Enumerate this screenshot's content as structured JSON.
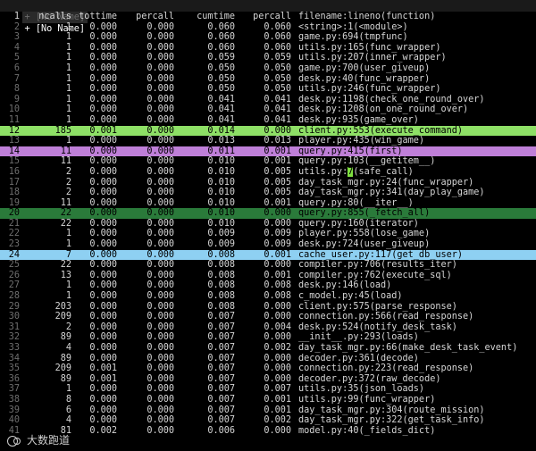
{
  "tabs": [
    {
      "label": "+ [No Name]",
      "active": false
    },
    {
      "label": "+ [No Name]",
      "active": true
    }
  ],
  "header": {
    "ncalls": "ncalls",
    "tottime": "tottime",
    "percall1": "percall",
    "cumtime": "cumtime",
    "percall2": "percall",
    "func": "filename:lineno(function)"
  },
  "rows": [
    {
      "ln": "2",
      "ncalls": "1",
      "tottime": "0.000",
      "percall1": "0.000",
      "cumtime": "0.060",
      "percall2": "0.060",
      "func": "<string>:1(<module>)",
      "hl": ""
    },
    {
      "ln": "3",
      "ncalls": "1",
      "tottime": "0.000",
      "percall1": "0.000",
      "cumtime": "0.060",
      "percall2": "0.060",
      "func": "game.py:694(tmpfunc)",
      "hl": ""
    },
    {
      "ln": "4",
      "ncalls": "1",
      "tottime": "0.000",
      "percall1": "0.000",
      "cumtime": "0.060",
      "percall2": "0.060",
      "func": "utils.py:165(func_wrapper)",
      "hl": ""
    },
    {
      "ln": "5",
      "ncalls": "1",
      "tottime": "0.000",
      "percall1": "0.000",
      "cumtime": "0.059",
      "percall2": "0.059",
      "func": "utils.py:207(inner_wrapper)",
      "hl": ""
    },
    {
      "ln": "6",
      "ncalls": "1",
      "tottime": "0.000",
      "percall1": "0.000",
      "cumtime": "0.050",
      "percall2": "0.050",
      "func": "game.py:700(user_giveup)",
      "hl": ""
    },
    {
      "ln": "7",
      "ncalls": "1",
      "tottime": "0.000",
      "percall1": "0.000",
      "cumtime": "0.050",
      "percall2": "0.050",
      "func": "desk.py:40(func_wrapper)",
      "hl": ""
    },
    {
      "ln": "8",
      "ncalls": "1",
      "tottime": "0.000",
      "percall1": "0.000",
      "cumtime": "0.050",
      "percall2": "0.050",
      "func": "utils.py:246(func_wrapper)",
      "hl": ""
    },
    {
      "ln": "9",
      "ncalls": "1",
      "tottime": "0.000",
      "percall1": "0.000",
      "cumtime": "0.041",
      "percall2": "0.041",
      "func": "desk.py:1198(check_one_round_over)",
      "hl": ""
    },
    {
      "ln": "10",
      "ncalls": "1",
      "tottime": "0.000",
      "percall1": "0.000",
      "cumtime": "0.041",
      "percall2": "0.041",
      "func": "desk.py:1208(on_one_round_over)",
      "hl": ""
    },
    {
      "ln": "11",
      "ncalls": "1",
      "tottime": "0.000",
      "percall1": "0.000",
      "cumtime": "0.041",
      "percall2": "0.041",
      "func": "desk.py:935(game_over)",
      "hl": ""
    },
    {
      "ln": "12",
      "ncalls": "185",
      "tottime": "0.001",
      "percall1": "0.000",
      "cumtime": "0.014",
      "percall2": "0.000",
      "func": "client.py:553(execute_command)",
      "hl": "green"
    },
    {
      "ln": "13",
      "ncalls": "1",
      "tottime": "0.000",
      "percall1": "0.000",
      "cumtime": "0.013",
      "percall2": "0.013",
      "func": "player.py:435(win_game)",
      "hl": ""
    },
    {
      "ln": "14",
      "ncalls": "11",
      "tottime": "0.000",
      "percall1": "0.000",
      "cumtime": "0.011",
      "percall2": "0.001",
      "func": "query.py:415(first)",
      "hl": "purple"
    },
    {
      "ln": "15",
      "ncalls": "11",
      "tottime": "0.000",
      "percall1": "0.000",
      "cumtime": "0.010",
      "percall2": "0.001",
      "func": "query.py:103(__getitem__)",
      "hl": ""
    },
    {
      "ln": "16",
      "ncalls": "2",
      "tottime": "0.000",
      "percall1": "0.000",
      "cumtime": "0.010",
      "percall2": "0.005",
      "func": "utils.py:",
      "cursor": "7",
      "funcTail": "(safe_call)",
      "hl": ""
    },
    {
      "ln": "17",
      "ncalls": "2",
      "tottime": "0.000",
      "percall1": "0.000",
      "cumtime": "0.010",
      "percall2": "0.005",
      "func": "day_task_mgr.py:24(func_wrapper)",
      "hl": ""
    },
    {
      "ln": "18",
      "ncalls": "2",
      "tottime": "0.000",
      "percall1": "0.000",
      "cumtime": "0.010",
      "percall2": "0.005",
      "func": "day_task_mgr.py:341(day_play_game)",
      "hl": ""
    },
    {
      "ln": "19",
      "ncalls": "11",
      "tottime": "0.000",
      "percall1": "0.000",
      "cumtime": "0.010",
      "percall2": "0.001",
      "func": "query.py:80(__iter__)",
      "hl": ""
    },
    {
      "ln": "20",
      "ncalls": "22",
      "tottime": "0.000",
      "percall1": "0.000",
      "cumtime": "0.010",
      "percall2": "0.000",
      "func": "query.py:855(_fetch_all)",
      "hl": "dkgreen"
    },
    {
      "ln": "21",
      "ncalls": "22",
      "tottime": "0.000",
      "percall1": "0.000",
      "cumtime": "0.010",
      "percall2": "0.000",
      "func": "query.py:160(iterator)",
      "hl": ""
    },
    {
      "ln": "22",
      "ncalls": "1",
      "tottime": "0.000",
      "percall1": "0.000",
      "cumtime": "0.009",
      "percall2": "0.009",
      "func": "player.py:558(lose_game)",
      "hl": ""
    },
    {
      "ln": "23",
      "ncalls": "1",
      "tottime": "0.000",
      "percall1": "0.000",
      "cumtime": "0.009",
      "percall2": "0.009",
      "func": "desk.py:724(user_giveup)",
      "hl": ""
    },
    {
      "ln": "24",
      "ncalls": "7",
      "tottime": "0.000",
      "percall1": "0.000",
      "cumtime": "0.008",
      "percall2": "0.001",
      "func": "cache_user.py:117(get_db_user)",
      "hl": "blue"
    },
    {
      "ln": "25",
      "ncalls": "22",
      "tottime": "0.000",
      "percall1": "0.000",
      "cumtime": "0.008",
      "percall2": "0.000",
      "func": "compiler.py:706(results_iter)",
      "hl": ""
    },
    {
      "ln": "26",
      "ncalls": "13",
      "tottime": "0.000",
      "percall1": "0.000",
      "cumtime": "0.008",
      "percall2": "0.001",
      "func": "compiler.py:762(execute_sql)",
      "hl": ""
    },
    {
      "ln": "27",
      "ncalls": "1",
      "tottime": "0.000",
      "percall1": "0.000",
      "cumtime": "0.008",
      "percall2": "0.008",
      "func": "desk.py:146(load)",
      "hl": ""
    },
    {
      "ln": "28",
      "ncalls": "1",
      "tottime": "0.000",
      "percall1": "0.000",
      "cumtime": "0.008",
      "percall2": "0.008",
      "func": "c_model.py:45(load)",
      "hl": ""
    },
    {
      "ln": "29",
      "ncalls": "203",
      "tottime": "0.000",
      "percall1": "0.000",
      "cumtime": "0.008",
      "percall2": "0.000",
      "func": "client.py:575(parse_response)",
      "hl": ""
    },
    {
      "ln": "30",
      "ncalls": "209",
      "tottime": "0.000",
      "percall1": "0.000",
      "cumtime": "0.007",
      "percall2": "0.000",
      "func": "connection.py:566(read_response)",
      "hl": ""
    },
    {
      "ln": "31",
      "ncalls": "2",
      "tottime": "0.000",
      "percall1": "0.000",
      "cumtime": "0.007",
      "percall2": "0.004",
      "func": "desk.py:524(notify_desk_task)",
      "hl": ""
    },
    {
      "ln": "32",
      "ncalls": "89",
      "tottime": "0.000",
      "percall1": "0.000",
      "cumtime": "0.007",
      "percall2": "0.000",
      "func": "__init__.py:293(loads)",
      "hl": ""
    },
    {
      "ln": "33",
      "ncalls": "4",
      "tottime": "0.000",
      "percall1": "0.000",
      "cumtime": "0.007",
      "percall2": "0.002",
      "func": "day_task_mgr.py:66(make_desk_task_event)",
      "hl": ""
    },
    {
      "ln": "34",
      "ncalls": "89",
      "tottime": "0.000",
      "percall1": "0.000",
      "cumtime": "0.007",
      "percall2": "0.000",
      "func": "decoder.py:361(decode)",
      "hl": ""
    },
    {
      "ln": "35",
      "ncalls": "209",
      "tottime": "0.001",
      "percall1": "0.000",
      "cumtime": "0.007",
      "percall2": "0.000",
      "func": "connection.py:223(read_response)",
      "hl": ""
    },
    {
      "ln": "36",
      "ncalls": "89",
      "tottime": "0.001",
      "percall1": "0.000",
      "cumtime": "0.007",
      "percall2": "0.000",
      "func": "decoder.py:372(raw_decode)",
      "hl": ""
    },
    {
      "ln": "37",
      "ncalls": "1",
      "tottime": "0.000",
      "percall1": "0.000",
      "cumtime": "0.007",
      "percall2": "0.007",
      "func": "utils.py:35(json_loads)",
      "hl": ""
    },
    {
      "ln": "38",
      "ncalls": "8",
      "tottime": "0.000",
      "percall1": "0.000",
      "cumtime": "0.007",
      "percall2": "0.001",
      "func": "utils.py:99(func_wrapper)",
      "hl": ""
    },
    {
      "ln": "39",
      "ncalls": "6",
      "tottime": "0.000",
      "percall1": "0.000",
      "cumtime": "0.007",
      "percall2": "0.001",
      "func": "day_task_mgr.py:304(route_mission)",
      "hl": ""
    },
    {
      "ln": "40",
      "ncalls": "4",
      "tottime": "0.000",
      "percall1": "0.000",
      "cumtime": "0.007",
      "percall2": "0.002",
      "func": "day_task_mgr.py:322(get_task_info)",
      "hl": ""
    },
    {
      "ln": "41",
      "ncalls": "81",
      "tottime": "0.002",
      "percall1": "0.000",
      "cumtime": "0.006",
      "percall2": "0.000",
      "func": "model.py:40(_fields_dict)",
      "hl": ""
    }
  ],
  "watermark": {
    "text": "大数跑道"
  }
}
